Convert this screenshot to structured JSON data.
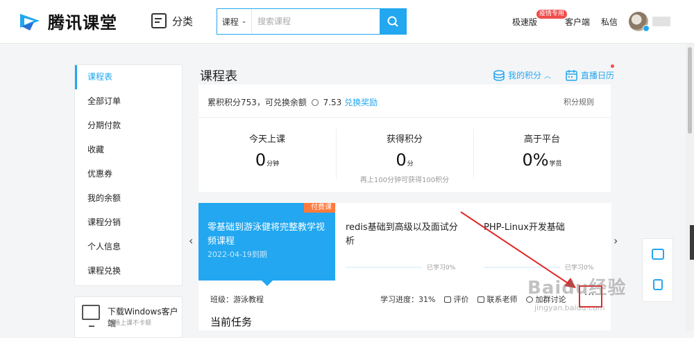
{
  "header": {
    "logo_text": "腾讯课堂",
    "category_label": "分类",
    "search": {
      "type_label": "课程",
      "placeholder": "搜索课程"
    },
    "nav": {
      "fast_label": "极速版",
      "fast_badge": "疫情专用",
      "client_label": "客户端",
      "message_label": "私信"
    }
  },
  "sidebar": {
    "items": [
      {
        "label": "课程表"
      },
      {
        "label": "全部订单"
      },
      {
        "label": "分期付款"
      },
      {
        "label": "收藏"
      },
      {
        "label": "优惠券"
      },
      {
        "label": "我的余额"
      },
      {
        "label": "课程分销"
      },
      {
        "label": "个人信息"
      },
      {
        "label": "课程兑换"
      }
    ],
    "download": {
      "title": "下载Windows客户端",
      "subtitle": "流畅上课不卡顿"
    }
  },
  "main": {
    "title": "课程表",
    "my_points_label": "我的积分",
    "live_calendar_label": "直播日历",
    "points": {
      "summary_prefix": "累积积分753，可兑换余额",
      "summary_value": "7.53",
      "redeem_label": "兑换奖励",
      "rules_label": "积分规则",
      "stats": [
        {
          "label": "今天上课",
          "value": "0",
          "unit": "分钟"
        },
        {
          "label": "获得积分",
          "value": "0",
          "unit": "分"
        },
        {
          "label": "高于平台",
          "value": "0%",
          "unit": "学员"
        }
      ],
      "tip": "再上100分钟可获得100积分"
    },
    "courses": [
      {
        "title": "零基础到游泳健将完整教学视频课程",
        "date": "2022-04-19到期",
        "tag": "付费课"
      },
      {
        "title": "redis基础到高级以及面试分析",
        "progress_label": "已学习0%",
        "progress": 0
      },
      {
        "title": "PHP-Linux开发基础",
        "progress_label": "已学习0%",
        "progress": 0
      }
    ],
    "class_info": {
      "class_label": "班级：游泳教程",
      "progress_label": "学习进度：31%",
      "review_label": "评价",
      "contact_label": "联系老师",
      "group_label": "加群讨论",
      "more_label": "···"
    },
    "current_task_label": "当前任务"
  },
  "watermark": {
    "text": "Baidu经验",
    "sub": "jingyan.baidu.com"
  },
  "colors": {
    "accent": "#22a7f0",
    "tag": "#ff7a3d",
    "annotation": "#e02b2b"
  }
}
